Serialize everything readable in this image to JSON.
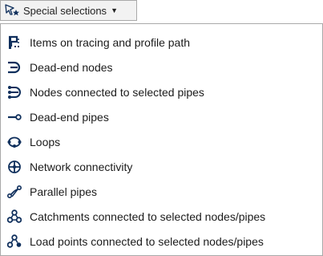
{
  "toolbar": {
    "button_label": "Special selections",
    "button_icon": "select-star-icon",
    "caret_icon": "chevron-down-icon"
  },
  "menu": {
    "items": [
      {
        "label": "Items on tracing and profile path",
        "icon": "tracing-path-icon"
      },
      {
        "label": "Dead-end nodes",
        "icon": "dead-end-node-icon"
      },
      {
        "label": "Nodes connected to selected pipes",
        "icon": "connected-nodes-icon"
      },
      {
        "label": "Dead-end pipes",
        "icon": "dead-end-pipe-icon"
      },
      {
        "label": "Loops",
        "icon": "loop-icon"
      },
      {
        "label": "Network connectivity",
        "icon": "network-connectivity-icon"
      },
      {
        "label": "Parallel pipes",
        "icon": "parallel-pipes-icon"
      },
      {
        "label": "Catchments connected to selected nodes/pipes",
        "icon": "catchments-icon"
      },
      {
        "label": "Load points connected to selected nodes/pipes",
        "icon": "load-points-icon"
      }
    ]
  },
  "colors": {
    "icon": "#0f2f5c",
    "text": "#1b1b1b",
    "border": "#a9a9a9"
  }
}
